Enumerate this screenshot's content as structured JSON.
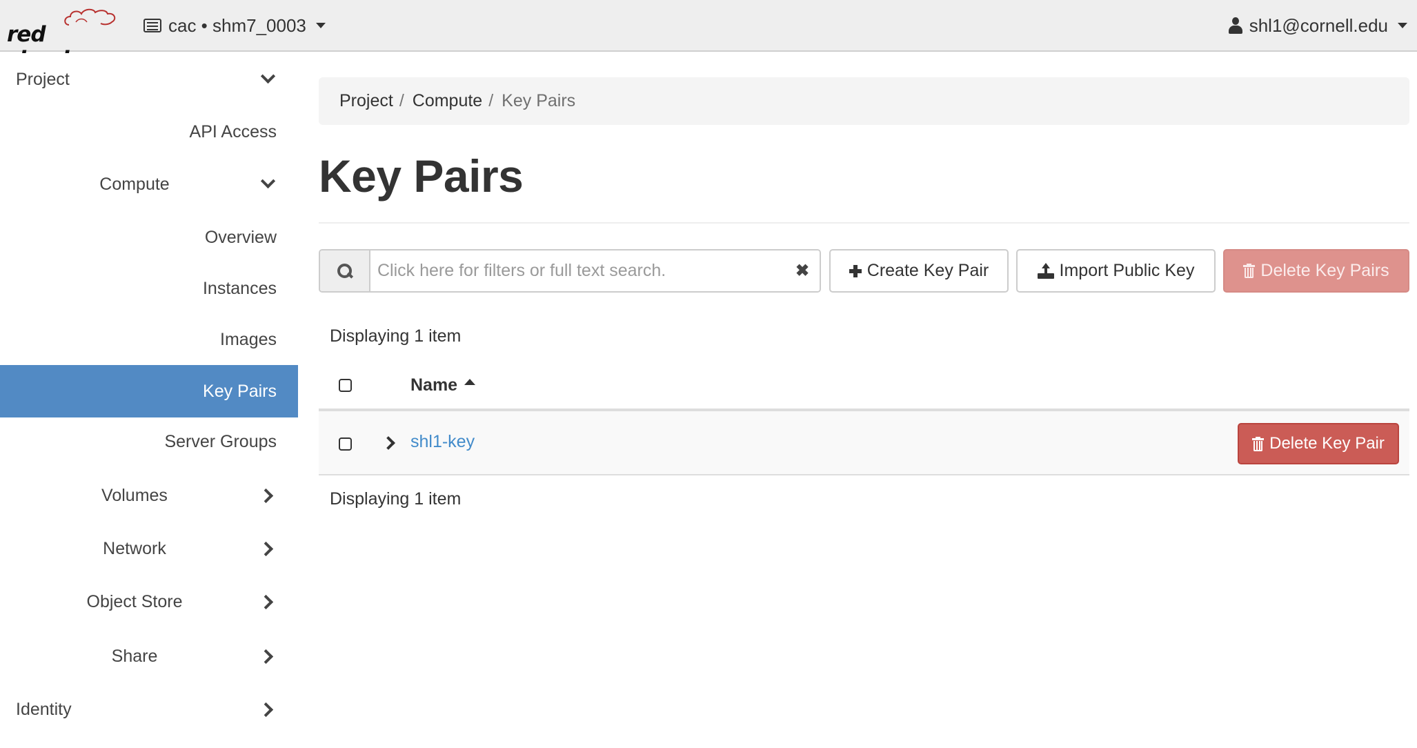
{
  "header": {
    "logo_text": "red cloud",
    "project_selector": {
      "domain": "cac",
      "separator": "•",
      "project": "shm7_0003",
      "label": "cac • shm7_0003"
    },
    "user_menu": {
      "label": "shl1@cornell.edu"
    }
  },
  "sidebar": {
    "items": [
      {
        "label": "Project",
        "level": 0,
        "chevron": "down"
      },
      {
        "label": "API Access",
        "level": 1
      },
      {
        "label": "Compute",
        "level": 1,
        "chevron": "down",
        "group": true
      },
      {
        "label": "Overview",
        "level": 2
      },
      {
        "label": "Instances",
        "level": 2
      },
      {
        "label": "Images",
        "level": 2
      },
      {
        "label": "Key Pairs",
        "level": 2,
        "active": true
      },
      {
        "label": "Server Groups",
        "level": 2
      },
      {
        "label": "Volumes",
        "level": 1,
        "chevron": "right",
        "group": true
      },
      {
        "label": "Network",
        "level": 1,
        "chevron": "right",
        "group": true
      },
      {
        "label": "Object Store",
        "level": 1,
        "chevron": "right",
        "group": true
      },
      {
        "label": "Share",
        "level": 1,
        "chevron": "right",
        "group": true
      },
      {
        "label": "Identity",
        "level": 0,
        "chevron": "right"
      }
    ]
  },
  "breadcrumb": {
    "items": [
      "Project",
      "Compute",
      "Key Pairs"
    ],
    "separator": "/"
  },
  "page": {
    "title": "Key Pairs"
  },
  "toolbar": {
    "search_placeholder": "Click here for filters or full text search.",
    "search_value": "",
    "clear_glyph": "✖",
    "create_label": "Create Key Pair",
    "import_label": "Import Public Key",
    "delete_label": "Delete Key Pairs"
  },
  "table": {
    "count_label": "Displaying 1 item",
    "columns": [
      {
        "label": "Name",
        "sort": "ascending"
      }
    ],
    "rows": [
      {
        "name": "shl1-key",
        "action_label": "Delete Key Pair"
      }
    ]
  },
  "colors": {
    "accent": "#528ac4",
    "link": "#428bca",
    "danger": "#cb5c56",
    "danger_disabled": "#de928d",
    "header_bg": "#eeeeee"
  }
}
